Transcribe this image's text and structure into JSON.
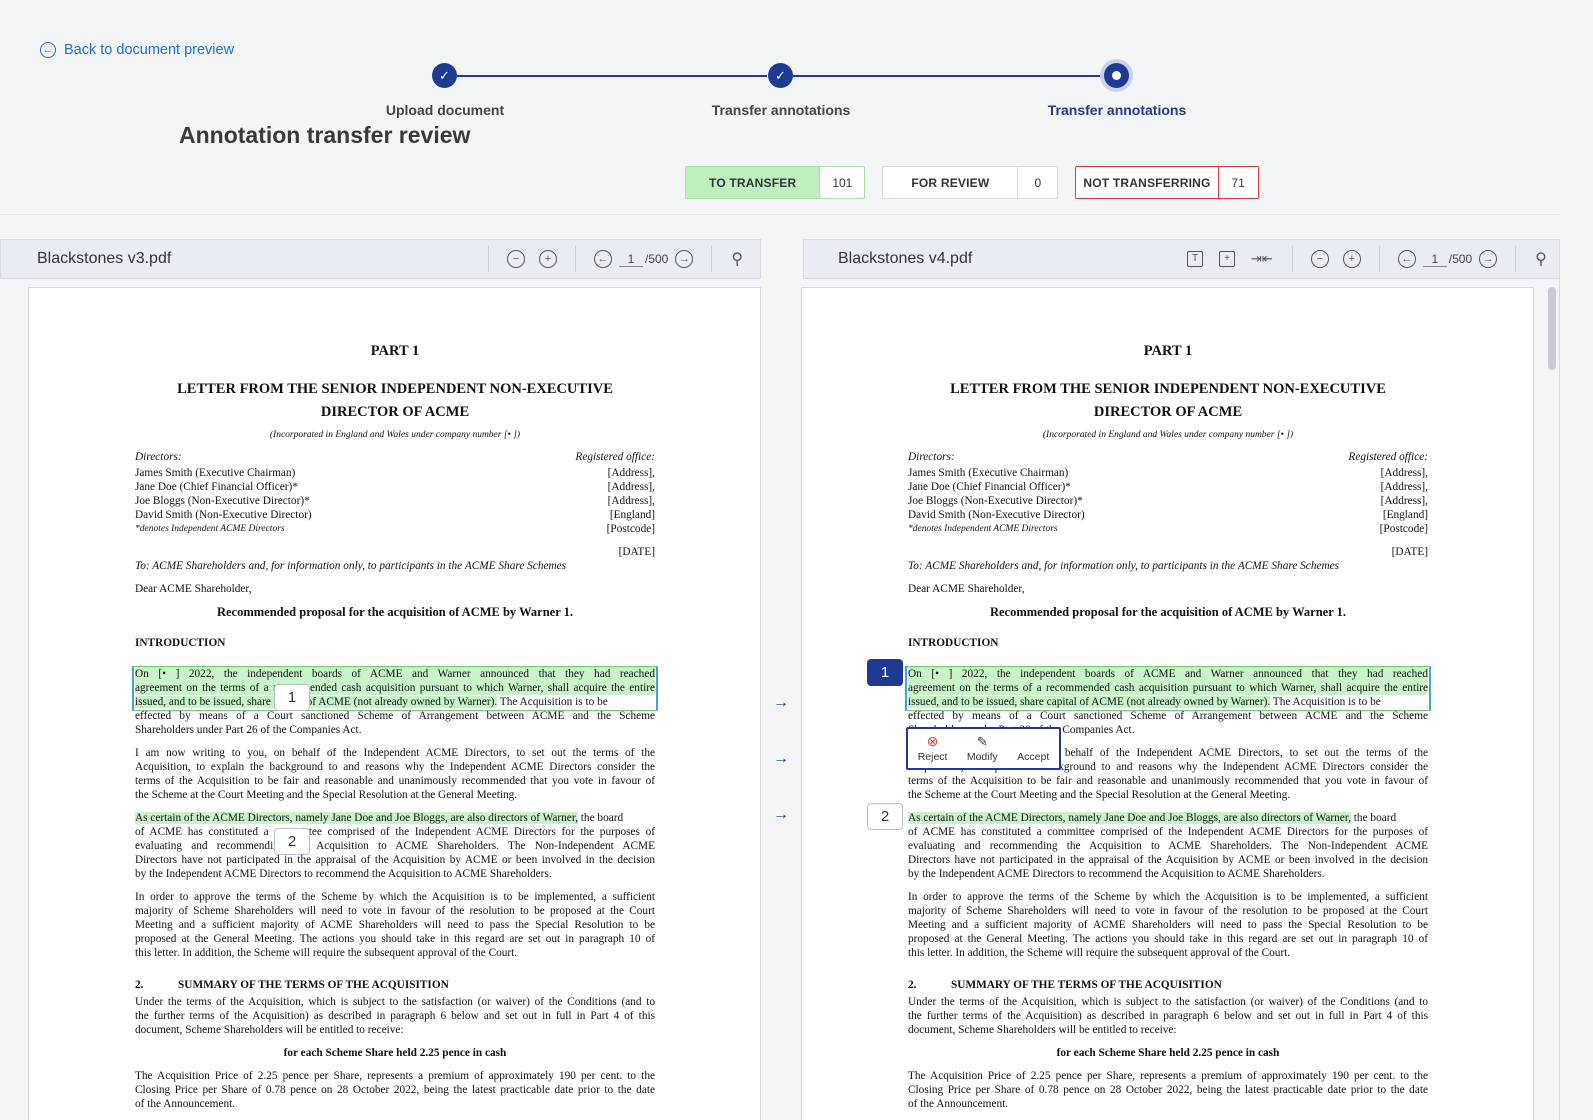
{
  "back_link": "Back to document preview",
  "stepper": {
    "steps": [
      {
        "label": "Upload document",
        "state": "done"
      },
      {
        "label": "Transfer annotations",
        "state": "done"
      },
      {
        "label": "Transfer annotations",
        "state": "current"
      }
    ],
    "check_glyph": "✓"
  },
  "page_title": "Annotation transfer review",
  "counters": {
    "to_transfer": {
      "label": "TO TRANSFER",
      "value": "101"
    },
    "for_review": {
      "label": "FOR REVIEW",
      "value": "0"
    },
    "not_transferring": {
      "label": "NOT TRANSFERRING",
      "value": "71"
    }
  },
  "left_pane": {
    "filename": "Blackstones v3.pdf",
    "page": "1",
    "total": "/500"
  },
  "right_pane": {
    "filename": "Blackstones v4.pdf",
    "page": "1",
    "total": "/500"
  },
  "popup": {
    "reject": "Reject",
    "modify": "Modify",
    "accept": "Accept"
  },
  "annotations": {
    "one": "1",
    "two": "2"
  },
  "document": {
    "part": "PART 1",
    "heading1": "LETTER FROM THE SENIOR INDEPENDENT NON-EXECUTIVE",
    "heading2": "DIRECTOR OF ACME",
    "incorporated": "(Incorporated in England and Wales under company number [•          ])",
    "directors_label": "Directors:",
    "registered_label": "Registered office:",
    "directors": [
      "James Smith (Executive Chairman)",
      "Jane Doe (Chief Financial Officer)*",
      "Joe Bloggs (Non-Executive Director)*",
      "David Smith (Non-Executive Director)",
      "*denotes Independent ACME Directors"
    ],
    "office": [
      "[Address],",
      "[Address],",
      "[Address],",
      "[England]",
      "[Postcode]"
    ],
    "date": "[DATE]",
    "to": "To: ACME Shareholders and, for information only, to participants in the ACME Share Schemes",
    "dear": "Dear ACME Shareholder,",
    "proposal": "Recommended proposal for the acquisition of ACME by Warner 1.",
    "intro": "INTRODUCTION",
    "p1": [
      "On [•          ] 2022, the independent boards of ACME and Warner announced that they had reached",
      "agreement on the terms of a recommended cash acquisition pursuant to which Warner, shall acquire the entire",
      "issued, and to be issued, share capital of ACME (not already owned by Warner).",
      "The Acquisition is to be",
      "effected by means of a Court sanctioned Scheme of Arrangement between ACME and the Scheme",
      "Shareholders under Part 26 of the Companies Act."
    ],
    "p2": [
      "I am now writing to you, on behalf of the Independent ACME Directors, to set out the terms of the",
      "Acquisition, to explain the background to and reasons why the Independent ACME Directors consider the",
      "terms of the Acquisition to be fair and reasonable and unanimously recommended that you vote in favour of",
      "the Scheme at the Court Meeting and the Special Resolution at the General Meeting."
    ],
    "p3": [
      "As certain of the ACME Directors, namely Jane Doe and Joe Bloggs, are also directors of Warner,",
      "the board",
      "of ACME has constituted a committee comprised of the Independent ACME Directors for the purposes of",
      "evaluating and recommending the Acquisition to ACME Shareholders. The Non-Independent ACME",
      "Directors have not participated in the appraisal of the Acquisition by ACME or been involved in the decision",
      "by the Independent ACME Directors to recommend the Acquisition to ACME Shareholders."
    ],
    "p4": [
      "In order to approve the terms of the Scheme by which the Acquisition is to be implemented, a sufficient",
      "majority of Scheme Shareholders will need to vote in favour of the resolution to be proposed at the Court",
      "Meeting and a sufficient majority of ACME Shareholders will need to pass the Special Resolution to be",
      "proposed at the General Meeting. The actions you should take in this regard are set out in paragraph 10 of",
      "this letter. In addition, the Scheme will require the subsequent approval of the Court."
    ],
    "sec2_num": "2.",
    "sec2_title": "SUMMARY OF THE TERMS OF THE ACQUISITION",
    "p5": [
      "Under the terms of the Acquisition, which is subject to the satisfaction (or waiver) of the Conditions (and to",
      "the further terms of the Acquisition) as described in paragraph 6 below and set out in full in Part 4 of this",
      "document, Scheme Shareholders will be entitled to receive:"
    ],
    "per_share": "for each Scheme Share held 2.25 pence in cash",
    "p6": [
      "The Acquisition Price of 2.25 pence per Share, represents a premium of approximately 190 per cent. to the",
      "Closing Price per Share of 0.78 pence on 28 October 2022, being the latest practicable date prior to the date",
      "of the Announcement."
    ]
  }
}
